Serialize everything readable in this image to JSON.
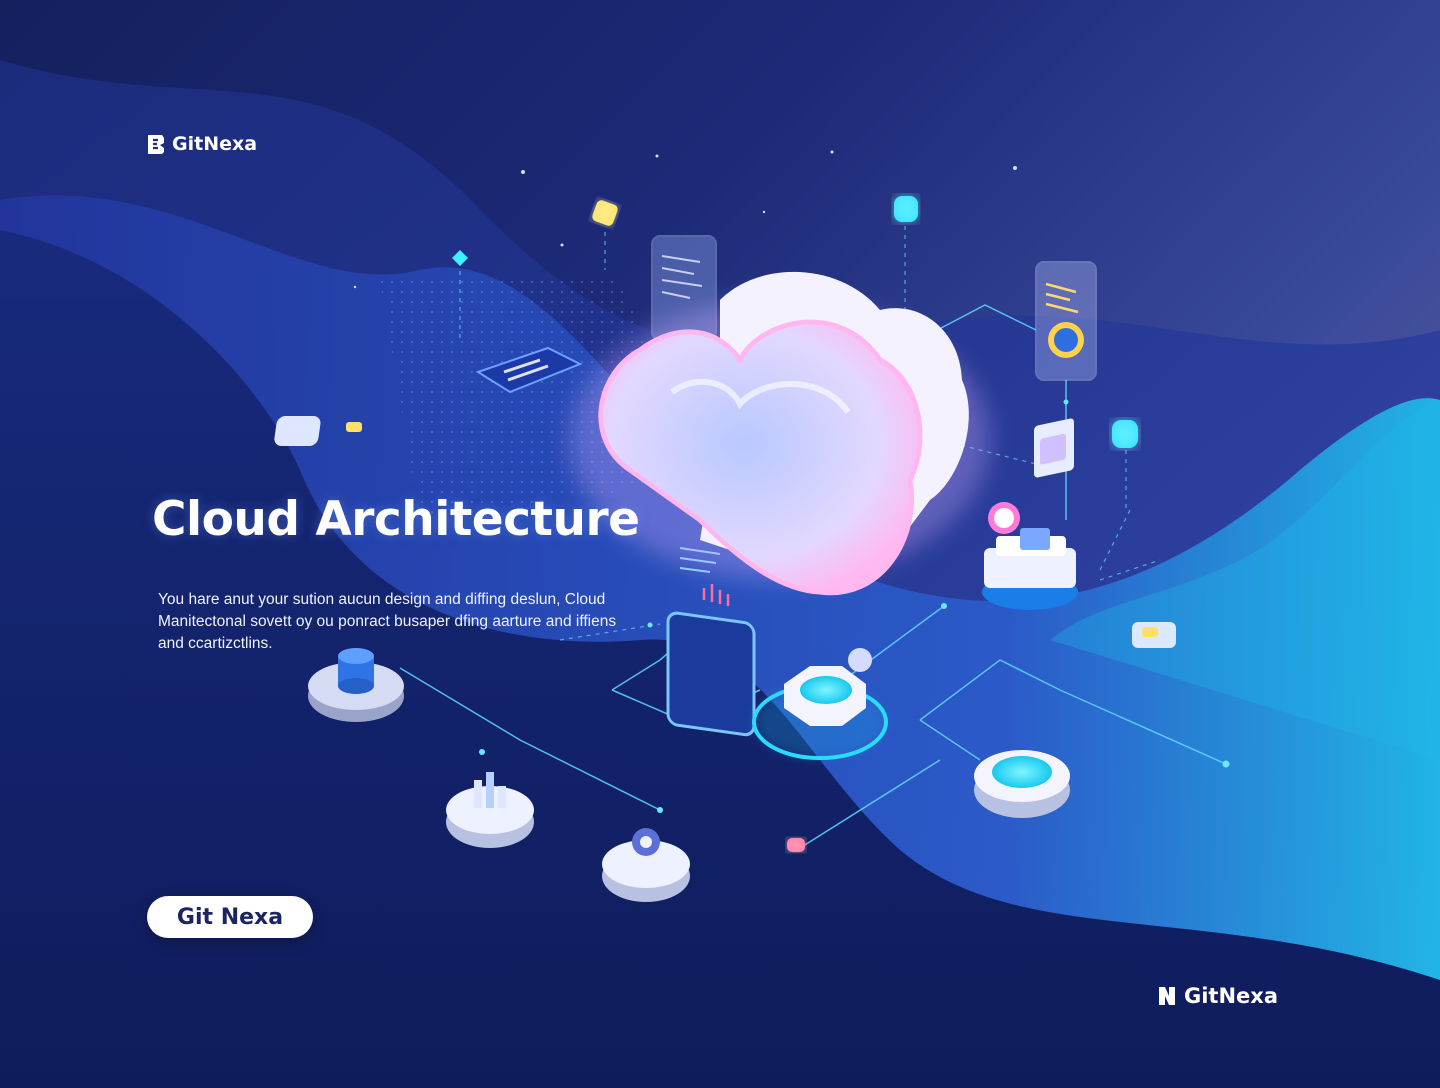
{
  "brand": {
    "top_logo_text": "GitNexa",
    "bottom_logo_text": "GitNexa"
  },
  "hero": {
    "title": "Cloud Architecture",
    "description": "You hare anut your sution aucun design and diffing deslun, Cloud Manitectonal sovett oy ou ponract busaper dfing aarture and iffiens and ccartizctlins."
  },
  "cta": {
    "label": "Git Nexa"
  },
  "colors": {
    "accent_cyan": "#2de0ff",
    "accent_pink": "#ff7ad9",
    "accent_yellow": "#ffe066",
    "bg_deep": "#14205e"
  },
  "illustration": {
    "icons": [
      "cloud-icon",
      "database-icon",
      "server-icon",
      "document-icon",
      "chart-panel-icon",
      "gear-icon",
      "lightbulb-icon",
      "bar-chart-icon",
      "security-icon",
      "cube-icon"
    ]
  }
}
